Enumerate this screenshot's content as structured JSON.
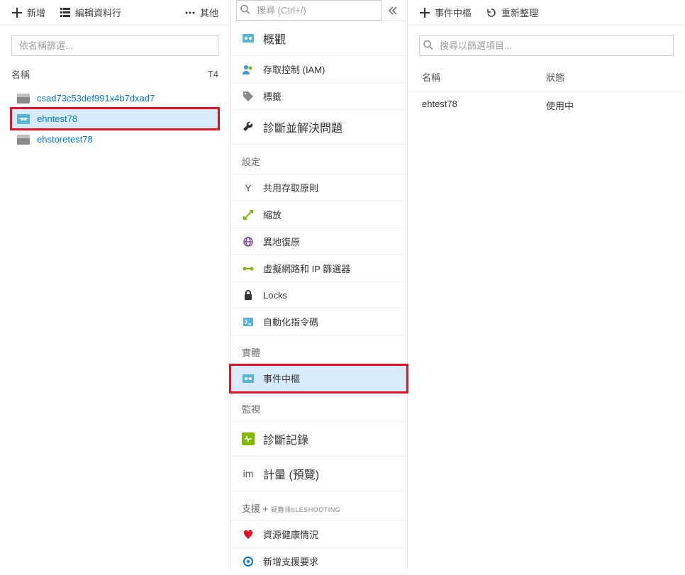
{
  "col1": {
    "toolbar": {
      "add": "新增",
      "editColumns": "編輯資料行",
      "more": "其他"
    },
    "filterPlaceholder": "依名稱篩選...",
    "header": {
      "name": "名稱",
      "sort": "T4"
    },
    "resources": [
      {
        "label": "csad73c53def991x4b7dxad7",
        "type": "storage",
        "selected": false
      },
      {
        "label": "ehntest78",
        "type": "eventhub",
        "selected": true
      },
      {
        "label": "ehstoretest78",
        "type": "storage",
        "selected": false
      }
    ]
  },
  "col2": {
    "searchPlaceholder": "搜尋 (Ctrl+/)",
    "items": [
      {
        "label": "概觀",
        "icon": "overview",
        "big": true
      },
      {
        "label": "存取控制 (IAM)",
        "icon": "iam"
      },
      {
        "label": "標籤",
        "icon": "tag"
      },
      {
        "label": "診斷並解決問題",
        "icon": "wrench",
        "big": true
      }
    ],
    "sections": [
      {
        "title": "設定",
        "items": [
          {
            "label": "共用存取原則",
            "iconText": "Y"
          },
          {
            "label": "縮放",
            "icon": "scale"
          },
          {
            "label": "異地復原",
            "icon": "globe"
          },
          {
            "label": "虛擬網路和 IP 篩選器",
            "icon": "vnet"
          },
          {
            "label": "Locks",
            "icon": "lock"
          },
          {
            "label": "自動化指令碼",
            "icon": "script"
          }
        ]
      },
      {
        "title": "實體",
        "items": [
          {
            "label": "事件中樞",
            "icon": "eh",
            "selected": true,
            "highlight": true
          }
        ]
      },
      {
        "title": "監視",
        "items": [
          {
            "label": "診斷記錄",
            "icon": "diag",
            "big": true
          },
          {
            "label": "計量 (預覽)",
            "iconText": "im",
            "big": true
          }
        ]
      },
      {
        "title": "支援 +",
        "trbSuffix": "疑難排bLESHOOTING",
        "items": [
          {
            "label": "資源健康情況",
            "icon": "health"
          },
          {
            "label": "新增支援要求",
            "icon": "support"
          }
        ]
      }
    ]
  },
  "col3": {
    "toolbar": {
      "eventHub": "事件中樞",
      "refresh": "重新整理"
    },
    "searchPlaceholder": "搜尋以篩選項目...",
    "columns": {
      "name": "名稱",
      "state": "狀態"
    },
    "rows": [
      {
        "name": "ehtest78",
        "state": "使用中"
      }
    ]
  }
}
